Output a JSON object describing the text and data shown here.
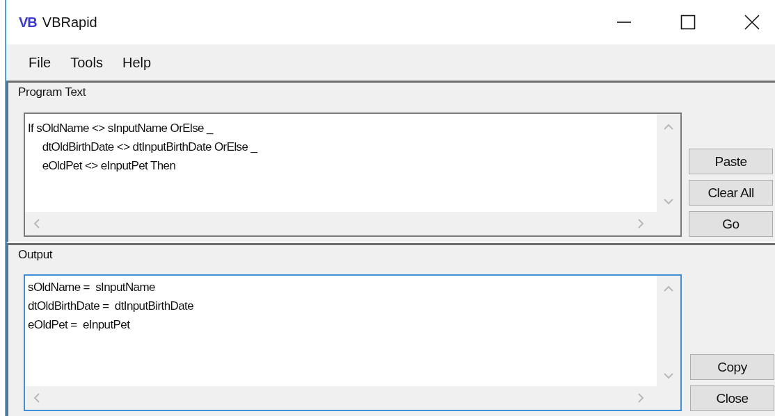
{
  "window": {
    "title": "VBRapid",
    "logo": "VB"
  },
  "menu": [
    "File",
    "Tools",
    "Help"
  ],
  "program_text": {
    "label": "Program Text",
    "focused": false,
    "lines": [
      "If sOldName <> sInputName OrElse _",
      "\tdtOldBirthDate <> dtInputBirthDate OrElse _",
      "\teOldPet <> eInputPet Then"
    ],
    "buttons": [
      "Paste",
      "Clear All",
      "Go"
    ]
  },
  "output": {
    "label": "Output",
    "focused": true,
    "lines": [
      "sOldName =  sInputName",
      "dtOldBirthDate =  dtInputBirthDate",
      "eOldPet =  eInputPet"
    ],
    "buttons": [
      "Copy",
      "Close"
    ]
  }
}
